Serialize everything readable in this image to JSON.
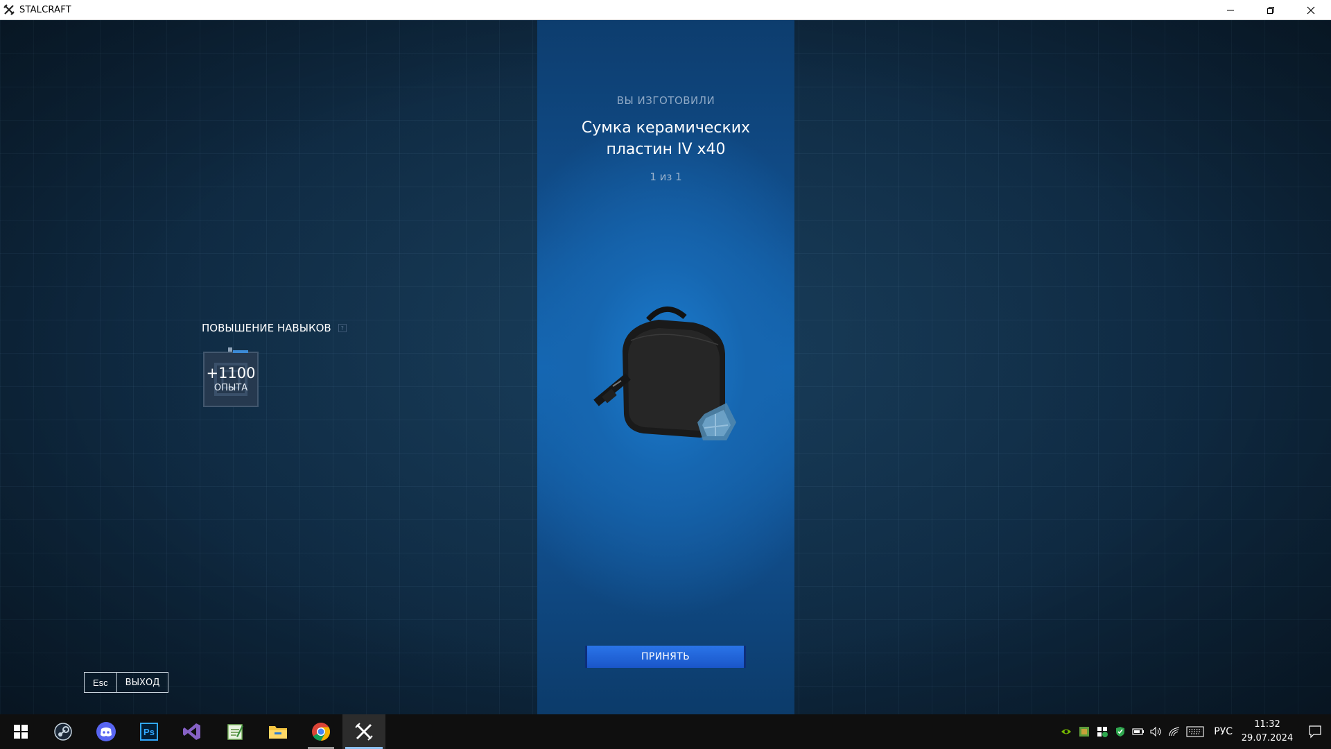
{
  "window": {
    "title": "STALCRAFT",
    "app_icon": "stalcraft-logo-icon",
    "controls": [
      "minimize-icon",
      "restore-icon",
      "close-icon"
    ]
  },
  "crafting_result": {
    "header": "ВЫ ИЗГОТОВИЛИ",
    "item_name_line1": "Сумка керамических",
    "item_name_line2": "пластин IV x40",
    "count": "1 из 1",
    "item_icon": "ceramic-plates-bag-icon",
    "accept_label": "ПРИНЯТЬ"
  },
  "skills": {
    "title": "ПОВЫШЕНИЕ НАВЫКОВ",
    "help_label": "?",
    "reward_value": "+1100",
    "reward_label": "ОПЫТА"
  },
  "exit": {
    "key": "Esc",
    "label": "ВЫХОД"
  },
  "taskbar": {
    "apps": [
      "steam-icon",
      "discord-icon",
      "photoshop-icon",
      "visual-studio-icon",
      "notepad-icon",
      "file-explorer-icon",
      "chrome-icon",
      "stalcraft-icon"
    ],
    "photoshop_label": "Ps",
    "language": "РУС",
    "time": "11:32",
    "date": "29.07.2024"
  },
  "colors": {
    "accept_button": "#1a56c9",
    "panel_blue": "#1468b5",
    "background": "#0c2236"
  }
}
